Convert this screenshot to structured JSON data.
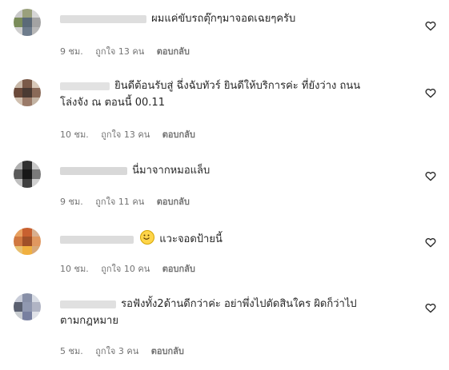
{
  "comments": [
    {
      "text": "ผมแค่ขับรถตุ๊กๆมาจอดเฉยๆครับ",
      "time": "9 ชม.",
      "likes": "ถูกใจ 13 คน",
      "reply": "ตอบกลับ",
      "colors": [
        "#c9c9c9",
        "#9aa07c",
        "#d6d6d6",
        "#7a8c5a",
        "#5b6a78",
        "#a3a3a3",
        "#cfcfcf",
        "#6e7c8c",
        "#b8b8b8"
      ],
      "username_width": 110
    },
    {
      "text_line1": "ยินดีต้อนรับสู่ ฉึ่งฉับทัวร์ ยินดีให้บริการค่ะ ที่ยังว่าง ถนน",
      "text_line2": "โล่งจัง ณ ตอนนี้ 00.11",
      "time": "10 ชม.",
      "likes": "ถูกใจ 13 คน",
      "reply": "ตอบกลับ",
      "colors": [
        "#c8b8a8",
        "#7a5a48",
        "#d8c8b8",
        "#6b4a3a",
        "#4a3a32",
        "#8a6a58",
        "#d0c0b0",
        "#9a7a68",
        "#c4b4a4"
      ],
      "username_width": 62
    },
    {
      "text": "นี่มาจากหมอแล็บ",
      "time": "9 ชม.",
      "likes": "ถูกใจ 11 คน",
      "reply": "ตอบกลับ",
      "colors": [
        "#b0b0b0",
        "#303030",
        "#c8c8c8",
        "#5a5a5a",
        "#181818",
        "#7a7a7a",
        "#c0c0c0",
        "#404040",
        "#d0d0d0"
      ],
      "username_width": 84
    },
    {
      "text": "แวะจอดป้ายนี้",
      "time": "10 ชม.",
      "likes": "ถูกใจ 10 คน",
      "reply": "ตอบกลับ",
      "colors": [
        "#e8a060",
        "#c86030",
        "#d8b090",
        "#d07840",
        "#a05028",
        "#e09860",
        "#e8c070",
        "#f0b040",
        "#d8a878"
      ],
      "username_width": 92
    },
    {
      "text_line1": "รอฟังทั้ง2ด้านดีกว่าค่ะ อย่าพึ่งไปตัดสินใคร ผิดก็ว่าไป",
      "text_line2": "ตามกฎหมาย",
      "time": "5 ชม.",
      "likes": "ถูกใจ 3 คน",
      "reply": "ตอบกลับ",
      "colors": [
        "#c8ccd8",
        "#8890a8",
        "#d8dce4",
        "#5a6070",
        "#9098b0",
        "#b0b4c4",
        "#c8ccd0",
        "#7880a0",
        "#e0e2e8"
      ],
      "username_width": 70
    }
  ],
  "icons": {
    "like": "heart-icon",
    "emoji": "smiling-face-emoji"
  }
}
